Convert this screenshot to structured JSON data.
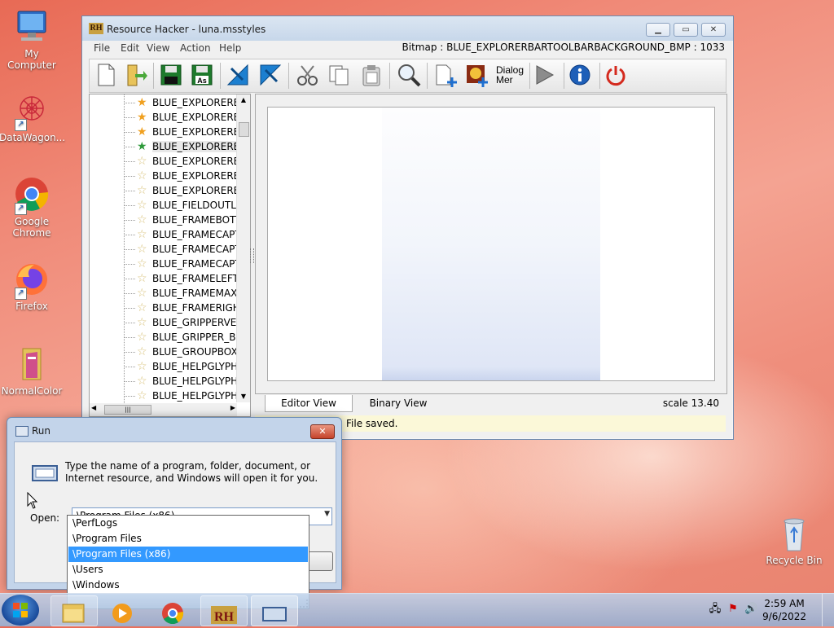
{
  "desktop": {
    "icons": [
      {
        "label": "My Computer",
        "icon": "computer-icon"
      },
      {
        "label": "DataWagon...",
        "icon": "datawagon-icon"
      },
      {
        "label": "Google Chrome",
        "icon": "chrome-icon"
      },
      {
        "label": "Firefox",
        "icon": "firefox-icon"
      },
      {
        "label": "NormalColor",
        "icon": "folder-icon"
      },
      {
        "label": "Recycle Bin",
        "icon": "recycle-bin-icon"
      }
    ]
  },
  "window": {
    "title": "Resource Hacker - luna.msstyles",
    "app_icon_text": "RH",
    "menu": [
      "File",
      "Edit",
      "View",
      "Action",
      "Help"
    ],
    "bitmap_info": "Bitmap : BLUE_EXPLORERBARTOOLBARBACKGROUND_BMP : 1033",
    "toolbar": {
      "buttons": [
        "new-icon",
        "open-icon",
        "save-icon",
        "save-as-icon",
        "prev-icon",
        "next-icon",
        "cut-icon",
        "copy-icon",
        "paste-icon",
        "search-icon",
        "add-resource-icon",
        "replace-icon",
        "dialog-menu-icon",
        "run-script-icon",
        "info-icon",
        "exit-icon"
      ],
      "save_as_text": "As",
      "dialog_menu_text": "Dialog\nMer"
    },
    "tree_items": [
      {
        "label": "BLUE_EXPLORERBA",
        "star": "orange"
      },
      {
        "label": "BLUE_EXPLORERBA",
        "star": "orange"
      },
      {
        "label": "BLUE_EXPLORERBA",
        "star": "orange"
      },
      {
        "label": "BLUE_EXPLORERBA",
        "star": "green",
        "selected": true
      },
      {
        "label": "BLUE_EXPLORERBA",
        "star": "outline"
      },
      {
        "label": "BLUE_EXPLORERBA",
        "star": "outline"
      },
      {
        "label": "BLUE_EXPLORERBA",
        "star": "outline"
      },
      {
        "label": "BLUE_FIELDOUTLI",
        "star": "outline"
      },
      {
        "label": "BLUE_FRAMEBOTT",
        "star": "outline"
      },
      {
        "label": "BLUE_FRAMECAPT",
        "star": "outline"
      },
      {
        "label": "BLUE_FRAMECAPT",
        "star": "outline"
      },
      {
        "label": "BLUE_FRAMECAPT",
        "star": "outline"
      },
      {
        "label": "BLUE_FRAMELEFT_",
        "star": "outline"
      },
      {
        "label": "BLUE_FRAMEMAXIN",
        "star": "outline"
      },
      {
        "label": "BLUE_FRAMERIGHT",
        "star": "outline"
      },
      {
        "label": "BLUE_GRIPPERVER",
        "star": "outline"
      },
      {
        "label": "BLUE_GRIPPER_BM",
        "star": "outline"
      },
      {
        "label": "BLUE_GROUPBOX_",
        "star": "outline"
      },
      {
        "label": "BLUE_HELPGLYPH1",
        "star": "outline"
      },
      {
        "label": "BLUE_HELPGLYPH2",
        "star": "outline"
      },
      {
        "label": "BLUE_HELPGLYPH(",
        "star": "outline"
      }
    ],
    "tabs": [
      "Editor View",
      "Binary View"
    ],
    "scale_label": "scale",
    "scale_value": "13.40",
    "status": "File saved."
  },
  "run_dialog": {
    "title": "Run",
    "description": "Type the name of a program, folder, document, or Internet resource, and Windows will open it for you.",
    "open_label": "Open:",
    "value": "\\Program Files (x86)",
    "suggestions": [
      "\\PerfLogs",
      "\\Program Files",
      "\\Program Files (x86)",
      "\\Users",
      "\\Windows"
    ],
    "highlighted_index": 2
  },
  "taskbar": {
    "buttons": [
      "explorer-icon",
      "media-player-icon",
      "chrome-icon",
      "resource-hacker-icon",
      "run-icon"
    ],
    "time": "2:59 AM",
    "date": "9/6/2022"
  },
  "colors": {
    "accent": "#3399ff",
    "status_bg": "#fbf8d8",
    "desktop": "#f08a78"
  }
}
